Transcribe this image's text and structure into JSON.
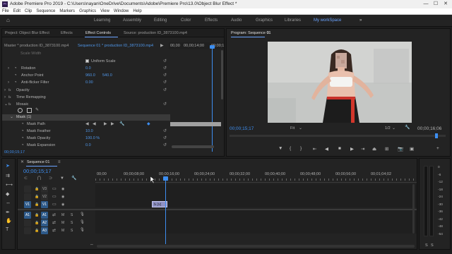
{
  "titlebar": {
    "title": "Adobe Premiere Pro 2019 - C:\\Users\\nayan\\OneDrive\\Documents\\Adobe\\Premiere Pro\\13.0\\Object Blur Effect *"
  },
  "menu": [
    "File",
    "Edit",
    "Clip",
    "Sequence",
    "Markers",
    "Graphics",
    "View",
    "Window",
    "Help"
  ],
  "workspaces": {
    "items": [
      "Learning",
      "Assembly",
      "Editing",
      "Color",
      "Effects",
      "Audio",
      "Graphics",
      "Libraries",
      "My workSpace"
    ],
    "more": "»"
  },
  "source_panel": {
    "tabs": [
      "Project: Object Blur Effect",
      "Effects",
      "Effect Controls",
      "Source: production ID_3873100.mp4"
    ],
    "active_tab": "Effect Controls",
    "master_label": "Master * production ID_3873100.mp4",
    "sequence_label": "Sequence 01 * production ID_3873100.mp4",
    "ruler_times": [
      "00,00",
      "00,00;14;00",
      "00;00;1"
    ],
    "props": {
      "scale_width": "Scale Width",
      "uniform_scale": "Uniform Scale",
      "rotation": "Rotation",
      "rotation_val": "0.0",
      "anchor": "Anchor Point",
      "anchor_x": "960.0",
      "anchor_y": "540.0",
      "antiflicker": "Anti-flicker Filter",
      "antiflicker_val": "0.00",
      "opacity": "Opacity",
      "time_remapping": "Time Remapping",
      "mosaic": "Mosaic",
      "mask": "Mask (1)",
      "mask_path": "Mask Path",
      "mask_feather": "Mask Feather",
      "mask_feather_val": "10.0",
      "mask_opacity": "Mask Opacity",
      "mask_opacity_val": "100.0 %",
      "mask_expansion": "Mask Expansion",
      "mask_expansion_val": "0.0"
    },
    "timecode": "00;00;15;17"
  },
  "program_panel": {
    "title": "Program: Sequence 01",
    "timecode": "00;00;15;17",
    "fit": "Fit",
    "fraction": "1/2",
    "duration": "00;00;16;06"
  },
  "timeline": {
    "tab": "Sequence 01",
    "timecode": "00;00;15;17",
    "ruler": [
      "00;00",
      "00;00;08;00",
      "00;00;16;00",
      "00;00;24;00",
      "00;00;32;00",
      "00;00;40;00",
      "00;00;48;00",
      "00;00;56;00",
      "00;01;04;02"
    ],
    "tracks": [
      {
        "src": "",
        "name": "V3"
      },
      {
        "src": "",
        "name": "V2"
      },
      {
        "src": "V1",
        "name": "V1"
      },
      {
        "src": "A1",
        "name": "A1"
      },
      {
        "src": "",
        "name": "A2"
      },
      {
        "src": "",
        "name": "A3"
      }
    ],
    "clip_label": "fx [V]"
  },
  "meter": {
    "scale": [
      "0",
      "-6",
      "-12",
      "-18",
      "-24",
      "-30",
      "-36",
      "-42",
      "-48",
      "-54"
    ],
    "bottom_labels": [
      "S",
      "S"
    ]
  },
  "colors": {
    "accent": "#3d8ef0",
    "clip": "#8f91c4"
  }
}
